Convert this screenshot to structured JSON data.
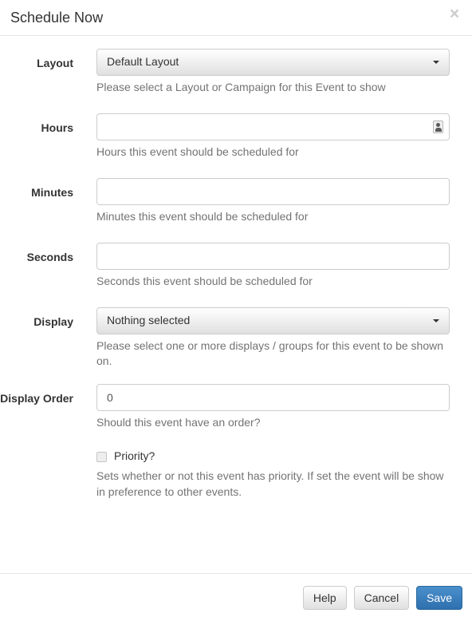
{
  "modal": {
    "title": "Schedule Now",
    "close_icon": "close-icon"
  },
  "form": {
    "layout": {
      "label": "Layout",
      "value": "Default Layout",
      "help": "Please select a Layout or Campaign for this Event to show",
      "caret_icon": "chevron-down-icon"
    },
    "hours": {
      "label": "Hours",
      "value": "",
      "placeholder": "",
      "help": "Hours this event should be scheduled for",
      "icon": "autofill-contact-icon"
    },
    "minutes": {
      "label": "Minutes",
      "value": "",
      "placeholder": "",
      "help": "Minutes this event should be scheduled for"
    },
    "seconds": {
      "label": "Seconds",
      "value": "",
      "placeholder": "",
      "help": "Seconds this event should be scheduled for"
    },
    "display": {
      "label": "Display",
      "value": "Nothing selected",
      "help": "Please select one or more displays / groups for this event to be shown on.",
      "caret_icon": "chevron-down-icon"
    },
    "display_order": {
      "label": "Display Order",
      "value": "0",
      "help": "Should this event have an order?"
    },
    "priority": {
      "label": "Priority?",
      "checked": false,
      "help": "Sets whether or not this event has priority. If set the event will be show in preference to other events."
    }
  },
  "footer": {
    "help_label": "Help",
    "cancel_label": "Cancel",
    "save_label": "Save"
  },
  "colors": {
    "primary": "#3b7ebf",
    "text": "#333333",
    "help_text": "#737373",
    "border": "#cccccc",
    "divider": "#e5e5e5"
  }
}
